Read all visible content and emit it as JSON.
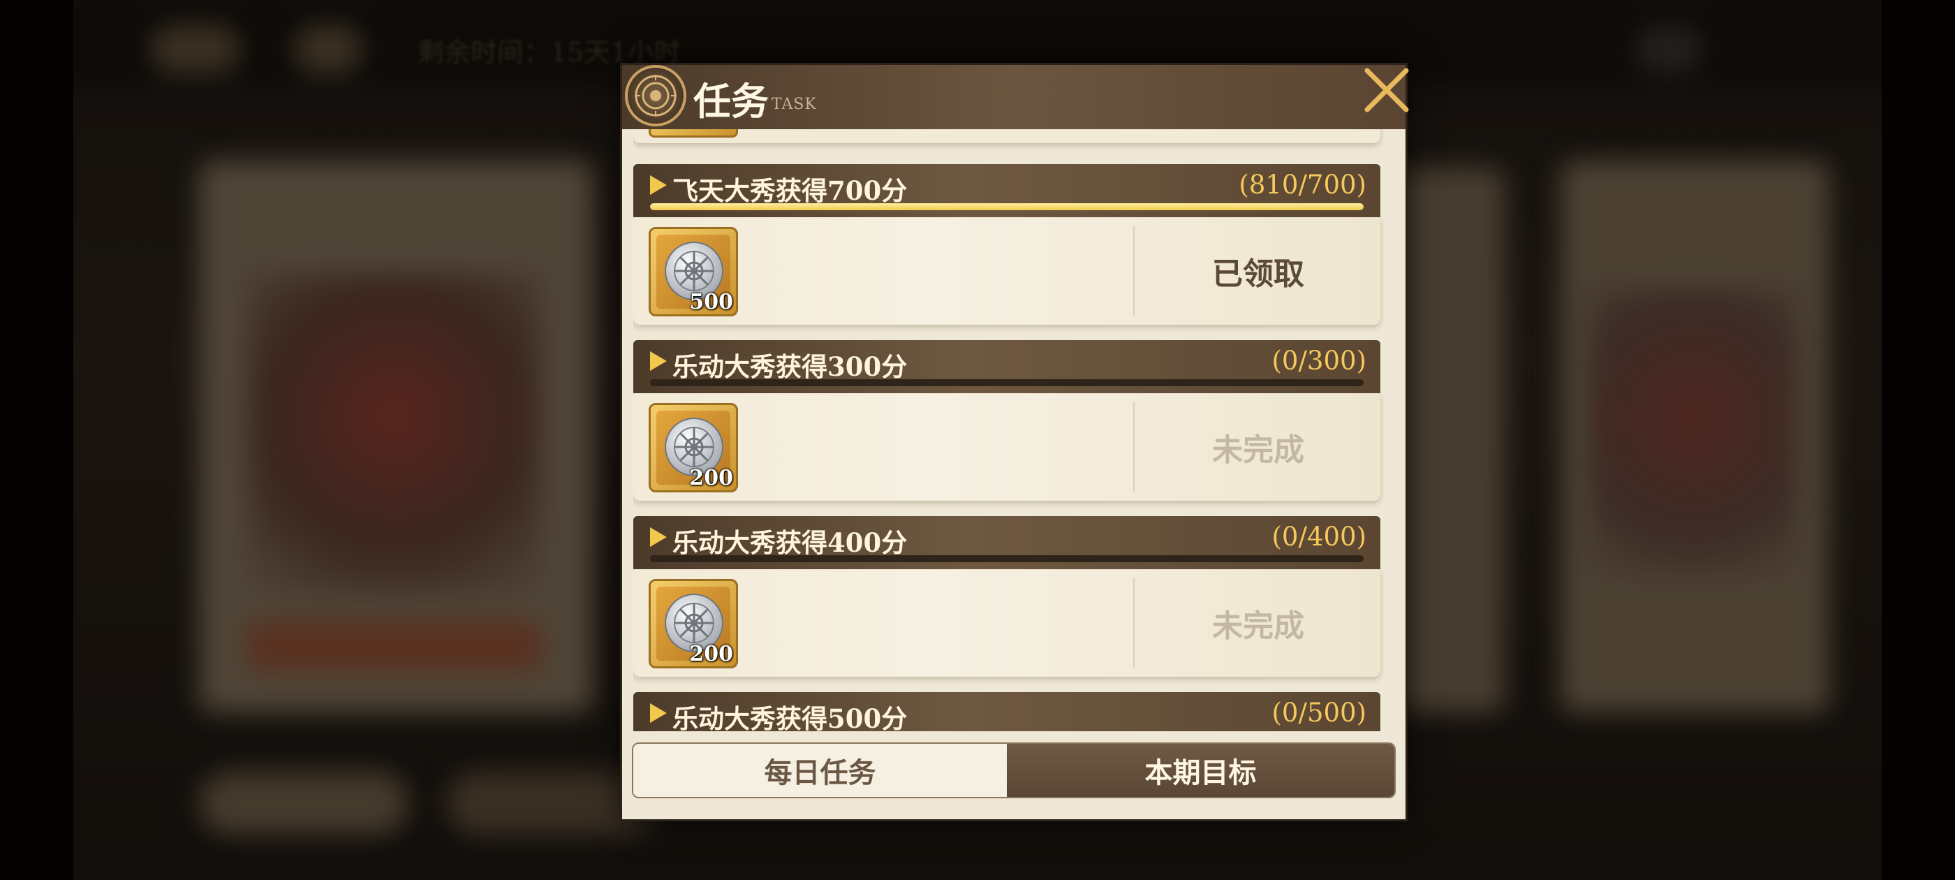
{
  "background": {
    "timer_text": "剩余时间：15天1小时"
  },
  "modal": {
    "title": "任务",
    "subtitle": "TASK",
    "close_icon": "close-x-icon"
  },
  "tasks": [
    {
      "title": "飞天大秀获得700分",
      "progress_text": "(810/700)",
      "progress_fraction": 1.0,
      "reward_icon": "silver-coin-icon",
      "reward_count": "500",
      "status": "已领取",
      "state": "claimed"
    },
    {
      "title": "乐动大秀获得300分",
      "progress_text": "(0/300)",
      "progress_fraction": 0,
      "reward_icon": "silver-coin-icon",
      "reward_count": "200",
      "status": "未完成",
      "state": "incomplete"
    },
    {
      "title": "乐动大秀获得400分",
      "progress_text": "(0/400)",
      "progress_fraction": 0,
      "reward_icon": "silver-coin-icon",
      "reward_count": "200",
      "status": "未完成",
      "state": "incomplete"
    },
    {
      "title": "乐动大秀获得500分",
      "progress_text": "(0/500)",
      "progress_fraction": 0
    }
  ],
  "tabs": [
    {
      "label": "每日任务",
      "selected": false
    },
    {
      "label": "本期目标",
      "selected": true
    }
  ],
  "colors": {
    "accent_gold": "#f2c94c",
    "header_brown": "#5a4532",
    "panel_cream": "#f3ebd8"
  }
}
